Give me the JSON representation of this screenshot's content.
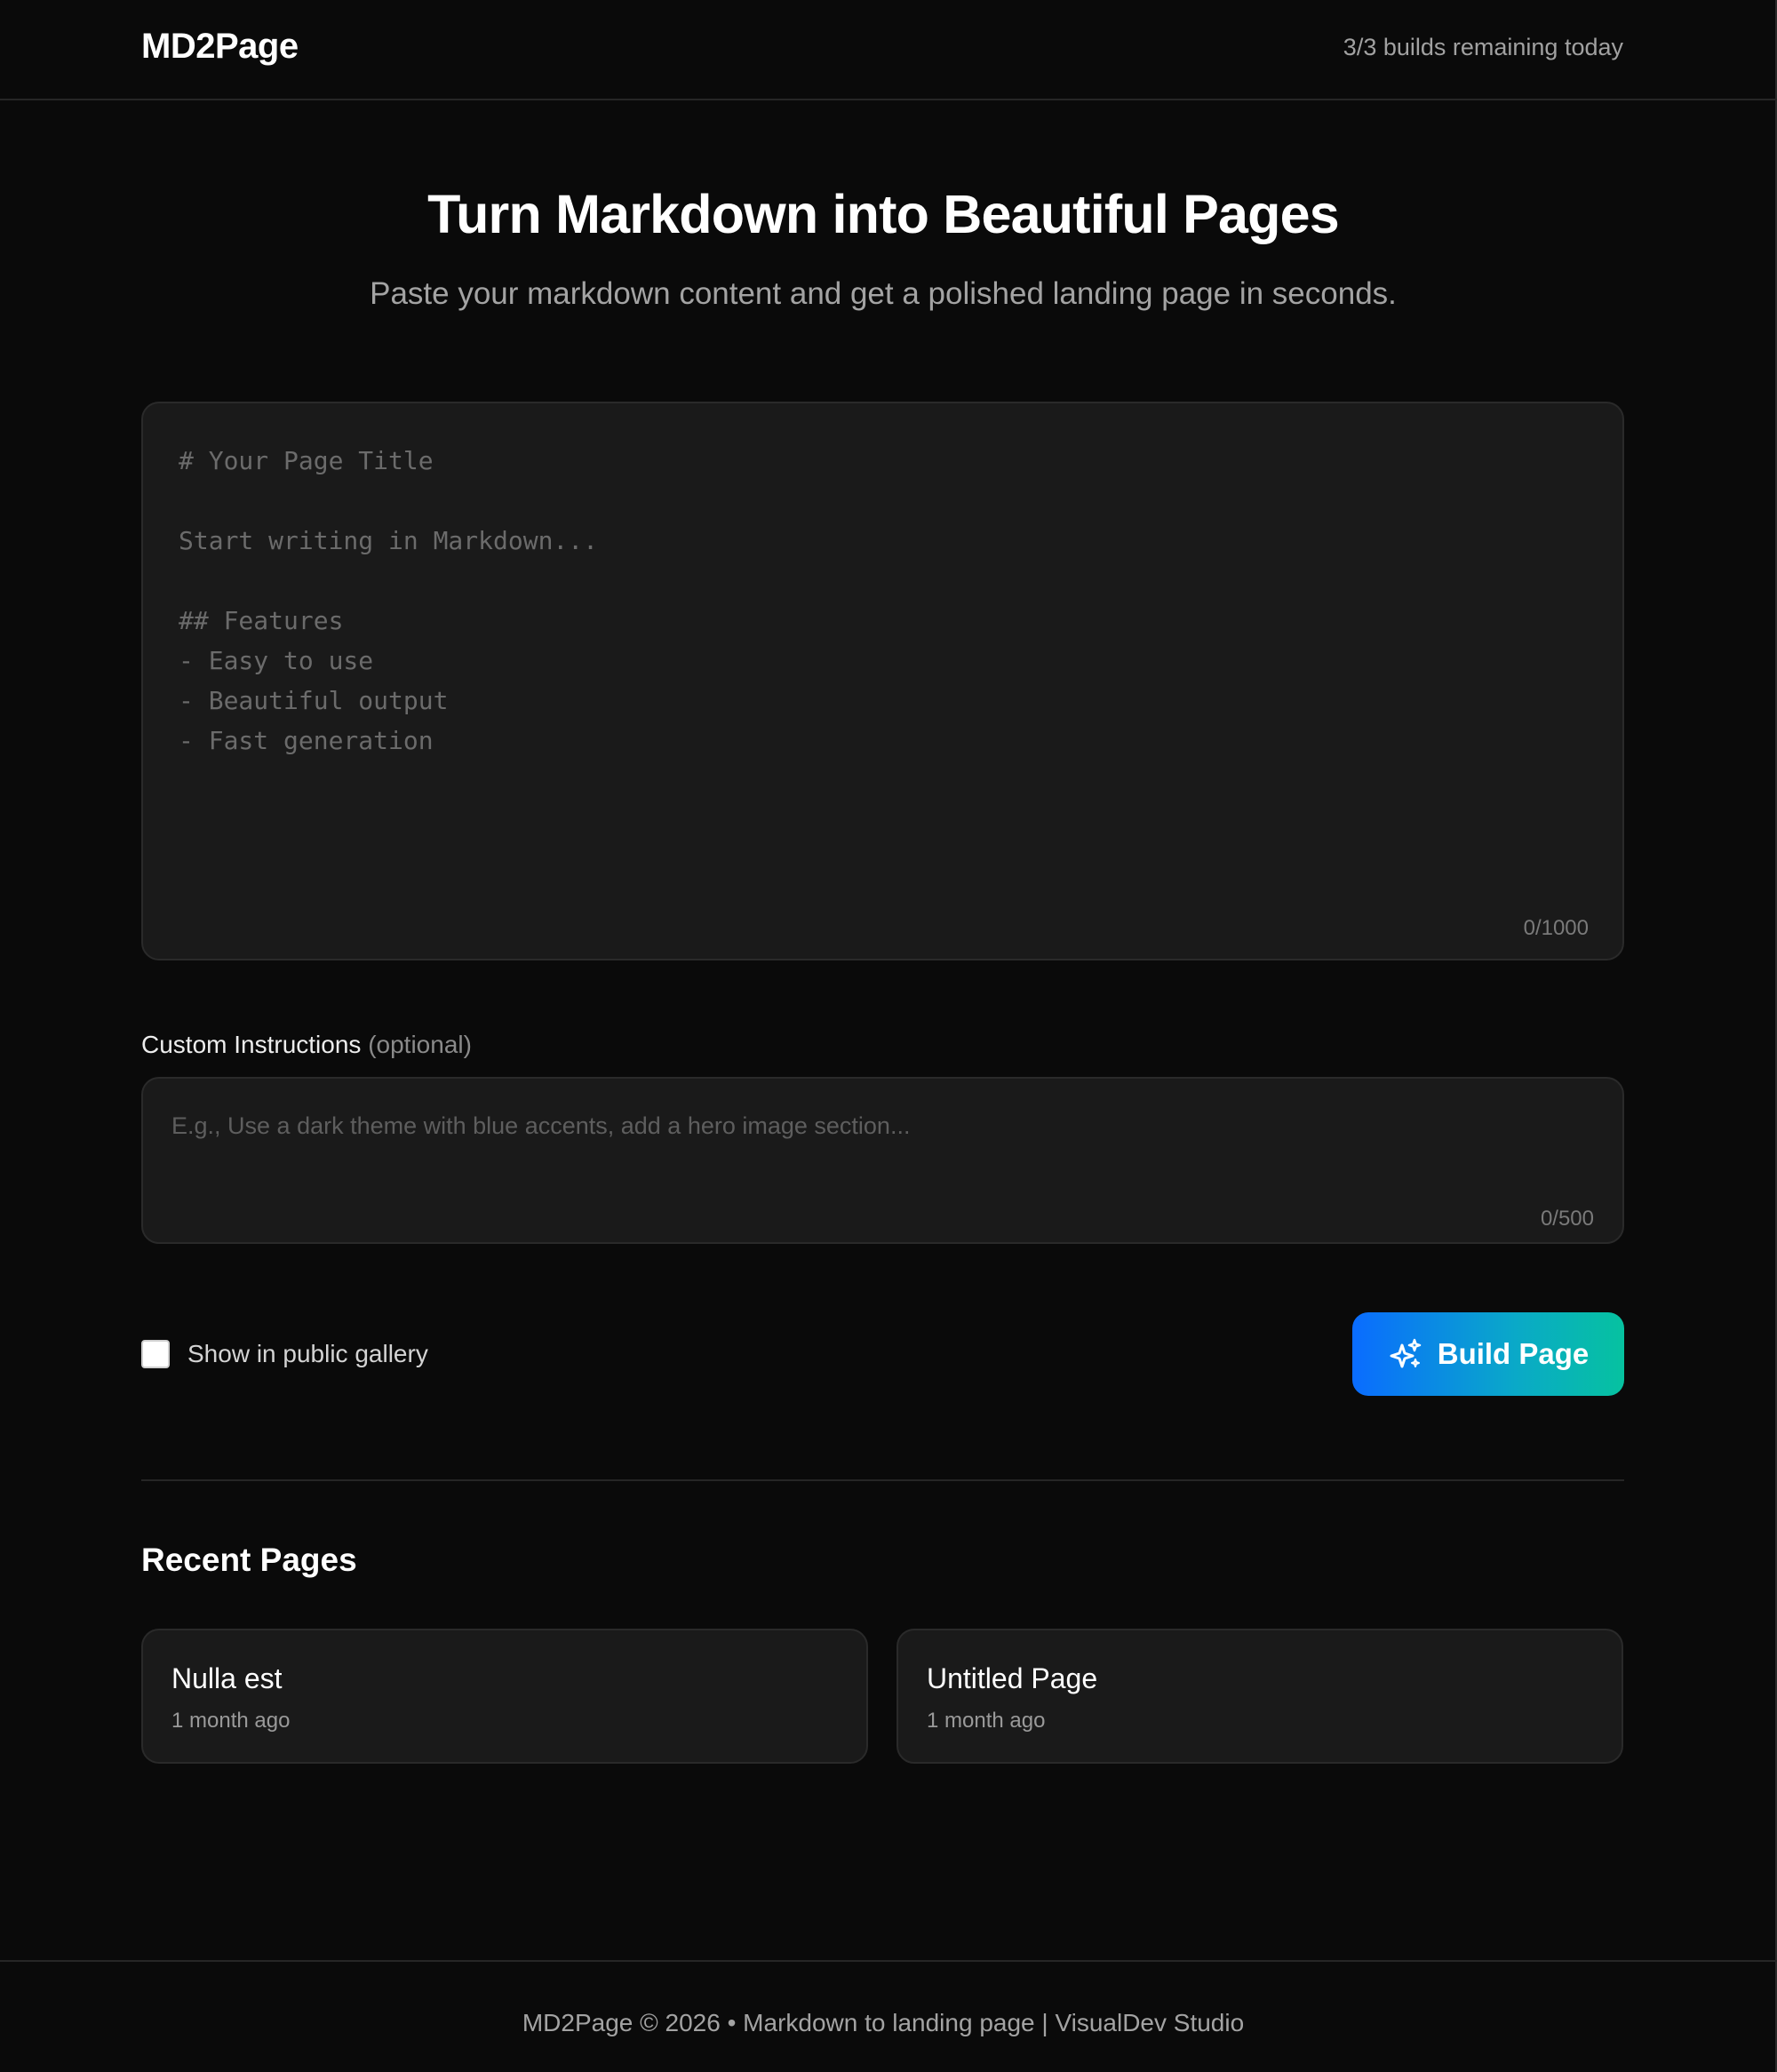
{
  "header": {
    "brand": "MD2Page",
    "builds_remaining": "3/3 builds remaining today"
  },
  "hero": {
    "title": "Turn Markdown into Beautiful Pages",
    "subtitle": "Paste your markdown content and get a polished landing page in seconds."
  },
  "editor": {
    "placeholder": "# Your Page Title\n\nStart writing in Markdown...\n\n## Features\n- Easy to use\n- Beautiful output\n- Fast generation",
    "value": "",
    "counter": "0/1000"
  },
  "custom_instructions": {
    "label": "Custom Instructions",
    "optional": "(optional)",
    "placeholder": "E.g., Use a dark theme with blue accents, add a hero image section...",
    "value": "",
    "counter": "0/500"
  },
  "gallery": {
    "label": "Show in public gallery",
    "checked": false
  },
  "build_button": {
    "label": "Build Page",
    "icon": "sparkles-icon",
    "gradient": [
      "#0a6cff",
      "#06c2a0"
    ]
  },
  "recent": {
    "title": "Recent Pages",
    "pages": [
      {
        "title": "Nulla est",
        "time": "1 month ago"
      },
      {
        "title": "Untitled Page",
        "time": "1 month ago"
      }
    ]
  },
  "footer": {
    "text": "MD2Page © 2026 • Markdown to landing page | VisualDev Studio"
  },
  "colors": {
    "background": "#0a0a0a",
    "surface": "#1a1a1a",
    "border": "#2a2a2a",
    "text": "#ededed",
    "muted": "#a3a3a3"
  }
}
